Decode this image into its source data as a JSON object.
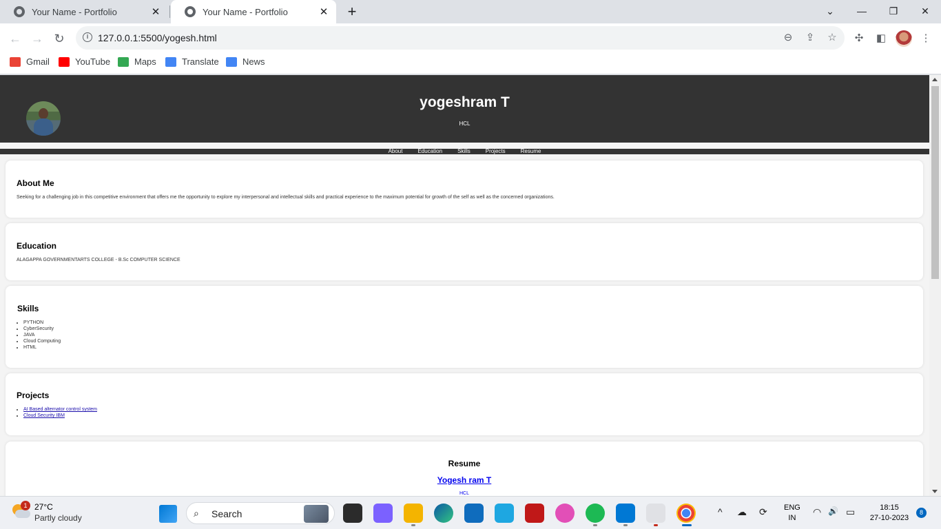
{
  "browser": {
    "tabs": [
      {
        "title": "Your Name - Portfolio",
        "close": "✕"
      },
      {
        "title": "Your Name - Portfolio",
        "close": "✕"
      }
    ],
    "new_tab": "+",
    "window_controls": {
      "dropdown": "⌄",
      "minimize": "—",
      "maximize": "❐",
      "close": "✕"
    },
    "nav": {
      "back": "←",
      "forward": "→",
      "reload": "↻"
    },
    "url": "127.0.0.1:5500/yogesh.html",
    "info_icon": "i",
    "omnibox_icons": {
      "zoom": "⊖",
      "share": "⇪",
      "bookmark": "☆"
    },
    "toolbar_icons": {
      "extensions": "✣",
      "side_panel": "◧",
      "menu": "⋮"
    },
    "bookmarks": [
      {
        "label": "Gmail",
        "color": "#ea4335"
      },
      {
        "label": "YouTube",
        "color": "#ff0000"
      },
      {
        "label": "Maps",
        "color": "#34a853"
      },
      {
        "label": "Translate",
        "color": "#4285f4"
      },
      {
        "label": "News",
        "color": "#4285f4"
      }
    ]
  },
  "page": {
    "header": {
      "name": "yogeshram T",
      "subtitle": "HCL"
    },
    "nav": [
      "About",
      "Education",
      "Skills",
      "Projects",
      "Resume"
    ],
    "about": {
      "title": "About Me",
      "text": "Seeking for a challenging job in this competitive environment that offers me the opportunity to explore my interpersonal and intellectual skills and practical experience to the maximum potential for growth of the self as well as the concerned organizations."
    },
    "education": {
      "title": "Education",
      "text": "ALAGAPPA GOVERNMENTARTS COLLEGE - B.Sc COMPUTER SCIENCE"
    },
    "skills": {
      "title": "Skills",
      "items": [
        "PYTHON",
        "CyberSecurity",
        "JAVA",
        "Cloud Computing",
        "HTML"
      ]
    },
    "projects": {
      "title": "Projects",
      "items": [
        "AI Based alternator control system",
        "Cloud Security IBM"
      ]
    },
    "resume": {
      "title": "Resume",
      "link": "Yogesh ram T",
      "sub": "HCL"
    }
  },
  "taskbar": {
    "weather": {
      "temp": "27°C",
      "desc": "Partly cloudy",
      "badge": "1"
    },
    "search_label": "Search",
    "search_icon": "⌕",
    "lang": {
      "line1": "ENG",
      "line2": "IN"
    },
    "clock": {
      "time": "18:15",
      "date": "27-10-2023"
    },
    "notifications": "8",
    "tray_icons": {
      "chevron": "^",
      "cloud": "☁",
      "sync": "⟳",
      "wifi": "◠",
      "volume": "🔊",
      "battery": "▭"
    }
  },
  "colors": {
    "header_bg": "#333333",
    "page_bg": "#f4f4f4",
    "link": "#0000ee"
  }
}
